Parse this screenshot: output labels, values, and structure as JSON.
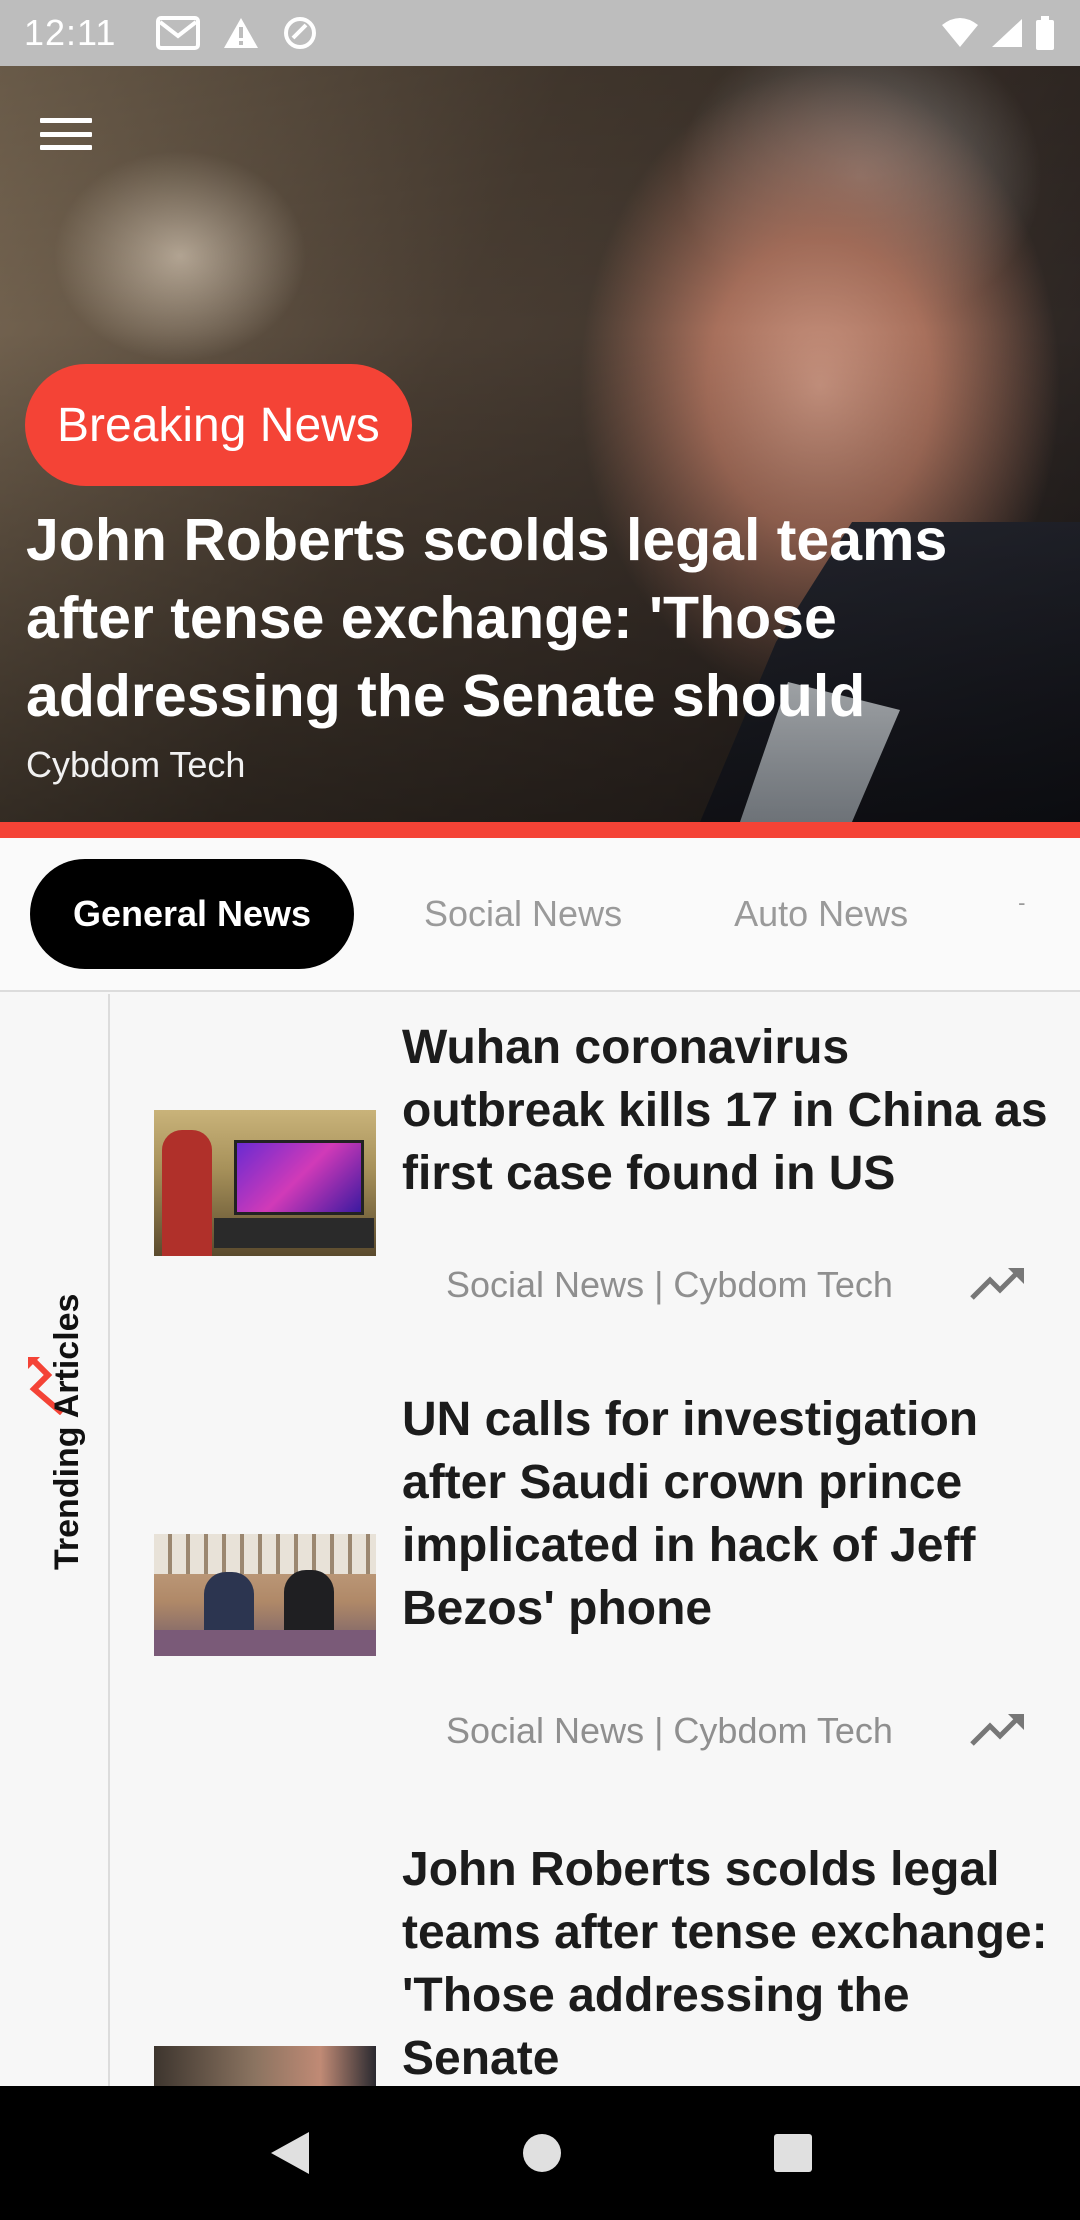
{
  "status_bar": {
    "time": "12:11",
    "left_icons": [
      "gmail-icon",
      "warning-icon",
      "sync-icon"
    ],
    "right_icons": [
      "wifi-icon",
      "signal-icon",
      "battery-icon"
    ]
  },
  "hero": {
    "badge": "Breaking News",
    "title": "John Roberts scolds legal teams after tense exchange: 'Those addressing the Senate should",
    "source": "Cybdom Tech",
    "accent_color": "#f44336"
  },
  "tabs": {
    "items": [
      "General News",
      "Social News",
      "Auto News",
      "-"
    ],
    "active": "General News"
  },
  "rail": {
    "label": "Trending Articles",
    "icon": "trending-arrow-icon"
  },
  "articles": [
    {
      "title": "Wuhan coronavirus outbreak kills 17 in China as first case found in US",
      "meta": "Social News | Cybdom Tech",
      "icon": "trending-up-icon"
    },
    {
      "title": "UN calls for investigation after Saudi crown prince implicated in hack of Jeff Bezos' phone",
      "meta": "Social News | Cybdom Tech",
      "icon": "trending-up-icon"
    },
    {
      "title": "John Roberts scolds legal teams after tense exchange: 'Those addressing the Senate",
      "meta": "",
      "icon": "trending-up-icon"
    }
  ],
  "nav_bar": {
    "buttons": [
      "back-icon",
      "home-icon",
      "recents-icon"
    ]
  }
}
